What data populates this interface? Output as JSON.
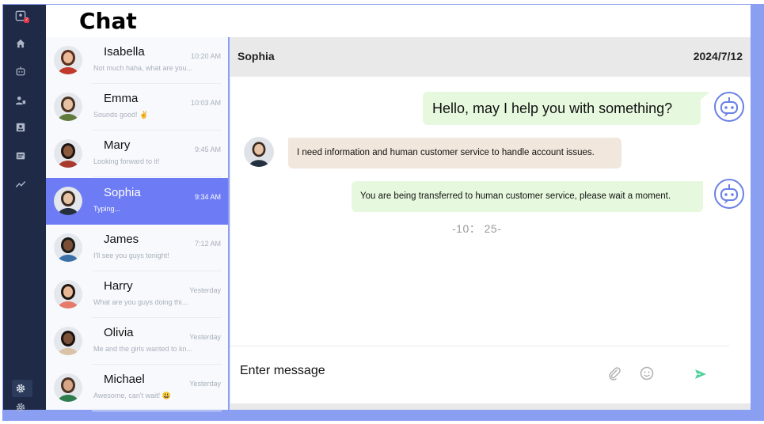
{
  "app": {
    "title": "Chat"
  },
  "contacts": [
    {
      "name": "Isabella",
      "time": "10:20 AM",
      "preview": "Not much haha, what are you...",
      "active": false,
      "skin": "#e9b99a",
      "hair": "#5a2f1c",
      "cloth": "#c0392b"
    },
    {
      "name": "Emma",
      "time": "10:03 AM",
      "preview": "Sounds good! ✌",
      "active": false,
      "skin": "#e7c1a3",
      "hair": "#4a3222",
      "cloth": "#5f7a3a"
    },
    {
      "name": "Mary",
      "time": "9:45 AM",
      "preview": "Looking forward to it!",
      "active": false,
      "skin": "#8b5a3c",
      "hair": "#1c1410",
      "cloth": "#a83a2e"
    },
    {
      "name": "Sophia",
      "time": "9:34 AM",
      "preview": "Typing...",
      "active": true,
      "skin": "#e6c3a5",
      "hair": "#3b2a20",
      "cloth": "#24303f"
    },
    {
      "name": "James",
      "time": "7:12 AM",
      "preview": "I'll see you guys tonight!",
      "active": false,
      "skin": "#7a4f35",
      "hair": "#1a1a1a",
      "cloth": "#3a6fa8"
    },
    {
      "name": "Harry",
      "time": "Yesterday",
      "preview": "What are you guys doing thi...",
      "active": false,
      "skin": "#e8b896",
      "hair": "#1e1612",
      "cloth": "#e57a6a"
    },
    {
      "name": "Olivia",
      "time": "Yesterday",
      "preview": "Me and the girls wanted to kn...",
      "active": false,
      "skin": "#7b5038",
      "hair": "#1a120e",
      "cloth": "#d9c2a5"
    },
    {
      "name": "Michael",
      "time": "Yesterday",
      "preview": "Awesome, can't wait! 😃",
      "active": false,
      "skin": "#d8a687",
      "hair": "#4b3326",
      "cloth": "#2f7d4e"
    }
  ],
  "chat": {
    "contact_name": "Sophia",
    "date": "2024/7/12",
    "messages": [
      {
        "from": "bot",
        "text": "Hello, may I help you with something?"
      },
      {
        "from": "user",
        "text": "I need information and human customer service to handle account issues."
      },
      {
        "from": "bot",
        "text": "You are being transferred to human customer service, please wait a moment."
      }
    ],
    "timer": "-10： 25-"
  },
  "composer": {
    "placeholder": "Enter message"
  },
  "colors": {
    "sidebar": "#1e2a46",
    "active_contact": "#6d7cf5",
    "bot_bubble": "#e6f9de",
    "user_bubble": "#f1e7dc",
    "frame": "#8a9ff2",
    "bot_icon": "#6a80e6",
    "send": "#4fd19a"
  },
  "icons": {
    "sidebar": [
      "inbox-icon",
      "home-icon",
      "robot-icon",
      "contacts-icon",
      "id-card-icon",
      "messages-icon",
      "chart-icon",
      "settings-icon",
      "settings-icon"
    ],
    "composer": [
      "paperclip-icon",
      "emoji-icon",
      "send-icon"
    ]
  }
}
